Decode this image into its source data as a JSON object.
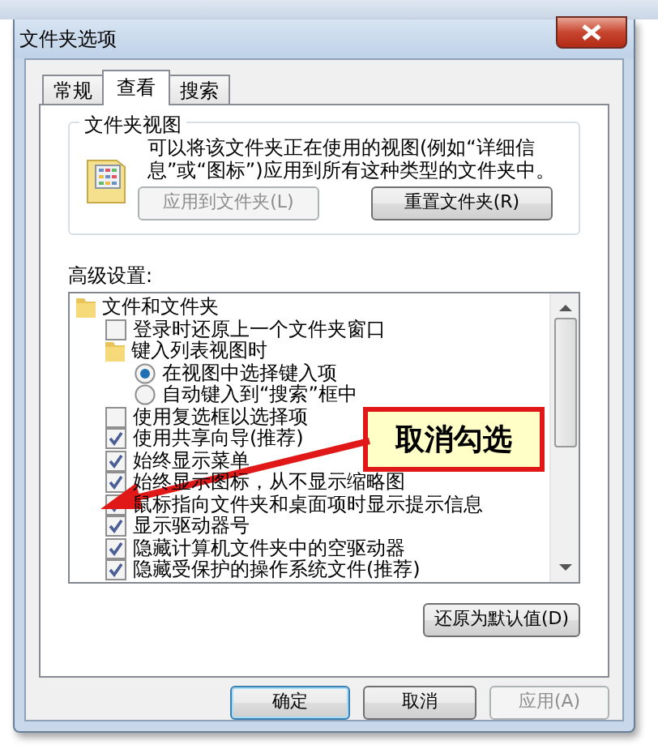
{
  "window": {
    "title": "文件夹选项"
  },
  "tabs": [
    {
      "label": "常规",
      "selected": false
    },
    {
      "label": "查看",
      "selected": true
    },
    {
      "label": "搜索",
      "selected": false
    }
  ],
  "folder_views": {
    "title": "文件夹视图",
    "description": "可以将该文件夹正在使用的视图(例如“详细信息”或“图标”)应用到所有这种类型的文件夹中。",
    "buttons": [
      {
        "label": "应用到文件夹(L)",
        "disabled": true
      },
      {
        "label": "重置文件夹(R)",
        "disabled": false
      }
    ]
  },
  "advanced": {
    "label": "高级设置:",
    "items": [
      {
        "kind": "folder",
        "label": "文件和文件夹",
        "children": [
          {
            "kind": "checkbox",
            "label": "登录时还原上一个文件夹窗口",
            "checked": false
          },
          {
            "kind": "folder",
            "label": "键入列表视图时",
            "children": [
              {
                "kind": "radio",
                "label": "在视图中选择键入项",
                "selected": true
              },
              {
                "kind": "radio",
                "label": "自动键入到“搜索”框中",
                "selected": false
              }
            ]
          },
          {
            "kind": "checkbox",
            "label": "使用复选框以选择项",
            "checked": false
          },
          {
            "kind": "checkbox",
            "label": "使用共享向导(推荐)",
            "checked": true
          },
          {
            "kind": "checkbox",
            "label": "始终显示菜单",
            "checked": true
          },
          {
            "kind": "checkbox",
            "label": "始终显示图标，从不显示缩略图",
            "checked": true
          },
          {
            "kind": "checkbox",
            "label": "鼠标指向文件夹和桌面项时显示提示信息",
            "checked": true
          },
          {
            "kind": "checkbox",
            "label": "显示驱动器号",
            "checked": true
          },
          {
            "kind": "checkbox",
            "label": "隐藏计算机文件夹中的空驱动器",
            "checked": true
          },
          {
            "kind": "checkbox",
            "label": "隐藏受保护的操作系统文件(推荐)",
            "checked": true
          }
        ]
      }
    ],
    "restore_button": "还原为默认值(D)"
  },
  "annotation": {
    "text": "取消勾选"
  },
  "buttons": [
    {
      "label": "确定",
      "disabled": false
    },
    {
      "label": "取消",
      "disabled": false
    },
    {
      "label": "应用(A)",
      "disabled": true
    }
  ]
}
